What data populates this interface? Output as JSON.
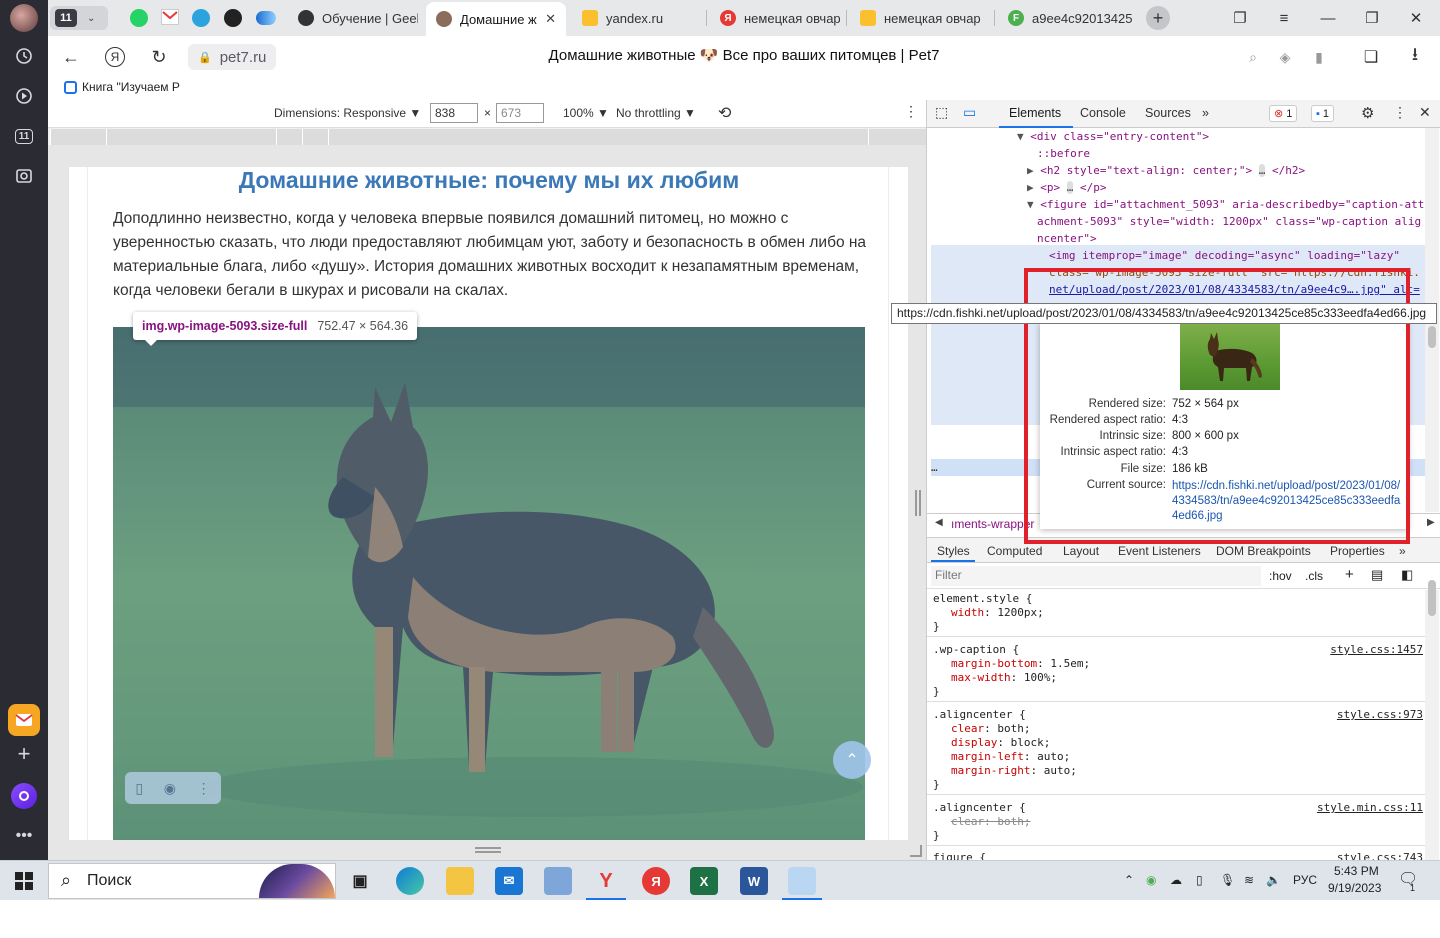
{
  "sidebar": {
    "counter": "11"
  },
  "tabs": {
    "counter": "11",
    "items": [
      {
        "label": "Обучение | Geek",
        "favicon": "GB"
      },
      {
        "label": "Домашние ж",
        "favicon": "pet"
      },
      {
        "label": "yandex.ru",
        "favicon": "img"
      },
      {
        "label": "немецкая овчар",
        "favicon": "Я"
      },
      {
        "label": "немецкая овчар",
        "favicon": "img"
      },
      {
        "label": "a9ee4c92013425",
        "favicon": "F"
      }
    ],
    "new_tab": "+"
  },
  "address": {
    "domain": "pet7.ru",
    "title": "Домашние животные 🐶 Все про ваших питомцев | Pet7"
  },
  "bookmarks": {
    "item": "Книга \"Изучаем Р"
  },
  "device_toolbar": {
    "dimensions": "Dimensions: Responsive ▼",
    "width": "838",
    "height": "673",
    "zoom": "100% ▼",
    "throttling": "No throttling ▼"
  },
  "article": {
    "heading": "Домашние животные: почему мы их любим",
    "paragraph": "Доподлинно  неизвестно, когда у человека впервые появился домашний питомец, но можно с уверенностью сказать, что люди предоставляют любимцам уют, заботу и безопасность в обмен либо на материальные блага, либо «душу». История домашних животных восходит к незапамятным временам, когда человеки бегали в шкурах и рисовали на скалах.",
    "inspect_selector": "img.wp-image-5093.size-full",
    "inspect_size": "752.47 × 564.36"
  },
  "devtools": {
    "tabs": [
      "Elements",
      "Console",
      "Sources"
    ],
    "errors": "1",
    "messages": "1",
    "dom_lines": [
      {
        "indent": 0,
        "arrow": "▼",
        "html": "div_entry"
      },
      {
        "indent": 1,
        "text": "::before"
      },
      {
        "indent": 1,
        "arrow": "▶",
        "text": "h2_line"
      }
    ],
    "dom": {
      "div_open": "<div class=\"entry-content\">",
      "before": "::before",
      "h2": "<h2 style=\"text-align: center;\">",
      "h2_close": "</h2>",
      "p": "<p>",
      "p_close": "</p>",
      "figure_1": "<figure id=\"attachment_5093\" aria-describedby=\"caption-att",
      "figure_2": "achment-5093\" style=\"width: 1200px\" class=\"wp-caption alig",
      "figure_3": "ncenter\">",
      "img_1": "<img itemprop=\"image\" decoding=\"async\" loading=\"lazy\"",
      "img_2": "class=\"wp-image-5093 size-full\" src=\"https://cdn.fishki.",
      "img_3": "net/upload/post/2023/01/08/4334583/tn/a9ee4c9….jpg\" alt=",
      "ellipsis": "…",
      "crumb": "ıments-wrapper"
    },
    "url_tooltip": "https://cdn.fishki.net/upload/post/2023/01/08/4334583/tn/a9ee4c92013425ce85c333eedfa4ed66.jpg",
    "image_info": {
      "rendered_size_k": "Rendered size:",
      "rendered_size_v": "752 × 564 px",
      "rendered_ratio_k": "Rendered aspect ratio:",
      "rendered_ratio_v": "4:3",
      "intrinsic_size_k": "Intrinsic size:",
      "intrinsic_size_v": "800 × 600 px",
      "intrinsic_ratio_k": "Intrinsic aspect ratio:",
      "intrinsic_ratio_v": "4:3",
      "file_size_k": "File size:",
      "file_size_v": "186 kB",
      "source_k": "Current source:",
      "source_v": "https://cdn.fishki.net/upload/post/2023/01/08/4334583/tn/a9ee4c92013425ce85c333eedfa4ed66.jpg"
    },
    "styles_tabs": [
      "Styles",
      "Computed",
      "Layout",
      "Event Listeners",
      "DOM Breakpoints",
      "Properties"
    ],
    "filter_placeholder": "Filter",
    "hov": ":hov",
    "cls": ".cls",
    "rules": {
      "r1_sel": "element.style {",
      "r1_p1": "width",
      "r1_v1": "1200px;",
      "r2_sel": ".wp-caption {",
      "r2_src": "style.css:1457",
      "r2_p1": "margin-bottom",
      "r2_v1": "1.5em;",
      "r2_p2": "max-width",
      "r2_v2": "100%;",
      "r3_sel": ".aligncenter {",
      "r3_src": "style.css:973",
      "r3_p1": "clear",
      "r3_v1": "both;",
      "r3_p2": "display",
      "r3_v2": "block;",
      "r3_p3": "margin-left",
      "r3_v3": "auto;",
      "r3_p4": "margin-right",
      "r3_v4": "auto;",
      "r4_sel": ".aligncenter {",
      "r4_src": "style.min.css:11",
      "r4_strike": "clear: both;",
      "r5_sel": "figure {",
      "r5_src": "style.css:743",
      "close": "}"
    }
  },
  "taskbar": {
    "search": "Поиск",
    "lang": "РУС",
    "time": "5:43 PM",
    "date": "9/19/2023",
    "notifications": "1"
  }
}
